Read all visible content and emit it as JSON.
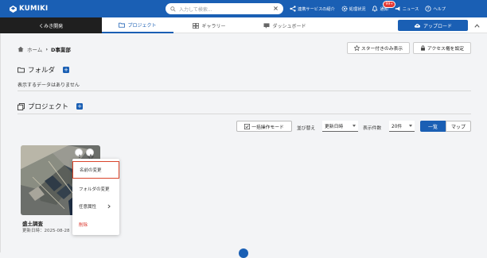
{
  "app": {
    "logo_text": "KUMIKI"
  },
  "search": {
    "placeholder": "入力して検索..."
  },
  "header_nav": {
    "services": "連携サービスの紹介",
    "status": "処理状況",
    "notifications": "通知",
    "notification_badge": "99+",
    "news": "ニュース",
    "help": "ヘルプ"
  },
  "tabs": {
    "team": "くみき開発",
    "project": "プロジェクト",
    "gallery": "ギャラリー",
    "dashboard": "ダッシュボード",
    "upload": "アップロード"
  },
  "breadcrumb": {
    "home": "ホーム",
    "current": "D事業部"
  },
  "actions": {
    "starred_only": "スター付きのみ表示",
    "access_settings": "アクセス権を設定"
  },
  "folders": {
    "title": "フォルダ",
    "empty": "表示するデータはありません"
  },
  "projects": {
    "title": "プロジェクト",
    "bulk_mode": "一括操作モード",
    "sort_label": "並び替え",
    "sort_value": "更新日時",
    "count_label": "表示件数",
    "count_value": "20件",
    "view_list": "一覧",
    "view_map": "マップ"
  },
  "card": {
    "title": "盛土調査",
    "date": "更新日時：2025-08-28"
  },
  "context_menu": {
    "rename": "名前の変更",
    "move_folder": "フォルダの変更",
    "attribute": "任意属性",
    "delete": "削除"
  },
  "colors": {
    "brand": "#1a5fb4",
    "danger": "#d93025",
    "highlight": "#d9442a"
  }
}
